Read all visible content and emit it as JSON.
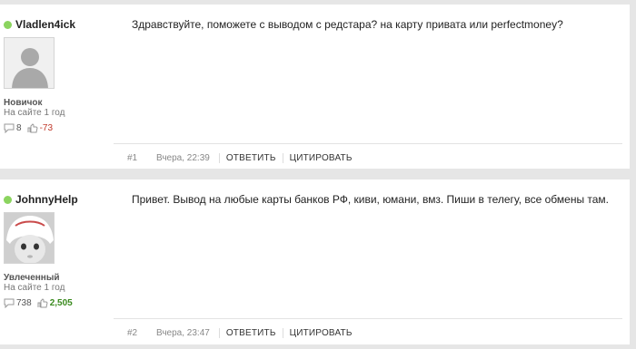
{
  "posts": [
    {
      "username": "Vladlen4ick",
      "rank": "Новичок",
      "since": "На сайте 1 год",
      "messages_count": "8",
      "reputation": "-73",
      "text": "Здравствуйте, поможете с выводом с редстара? на карту привата или perfectmoney?",
      "number": "#1",
      "date": "Вчера, 22:39",
      "reply_label": "ОТВЕТИТЬ",
      "quote_label": "ЦИТИРОВАТЬ"
    },
    {
      "username": "JohnnyHelp",
      "rank": "Увлеченный",
      "since": "На сайте 1 год",
      "messages_count": "738",
      "reputation": "2,505",
      "text": "Привет. Вывод на любые карты банков РФ, киви, юмани, вмз. Пиши в телегу, все обмены там.",
      "number": "#2",
      "date": "Вчера, 23:47",
      "reply_label": "ОТВЕТИТЬ",
      "quote_label": "ЦИТИРОВАТЬ"
    }
  ],
  "colors": {
    "online": "#8bd45f",
    "reputation_negative": "#c0392b",
    "reputation_positive": "#3a8a1e"
  }
}
